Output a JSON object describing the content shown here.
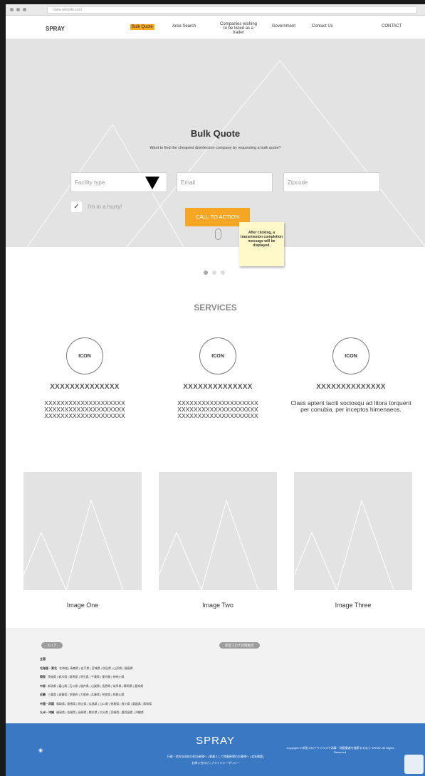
{
  "browser": {
    "url": "www.website.com"
  },
  "header": {
    "logo": "SPRAY",
    "nav": [
      {
        "label": "Bulk Quote",
        "active": true
      },
      {
        "label": "Area Search"
      },
      {
        "label": "Companies wishing to be listed as a trader"
      },
      {
        "label": "Government"
      },
      {
        "label": "Contact Us"
      }
    ],
    "contact": "CONTACT"
  },
  "hero": {
    "title": "Bulk Quote",
    "subtitle": "Want to find the cheapest disinfection company by requesting a bulk quote?",
    "facility_placeholder": "Facility type",
    "email_placeholder": "Email",
    "zipcode_placeholder": "Zipcode",
    "hurry_label": "I'm in a hurry!",
    "cta_label": "CALL TO ACTION",
    "note": "After clicking, a transmission completion message will be displayed."
  },
  "colors": {
    "accent": "#f5a623",
    "footer": "#3a78c4",
    "note": "#fff8c9"
  },
  "services": {
    "title": "SERVICES",
    "items": [
      {
        "icon": "ICON",
        "heading": "XXXXXXXXXXXXXX",
        "body": "XXXXXXXXXXXXXXXXXXXX XXXXXXXXXXXXXXXXXXXX XXXXXXXXXXXXXXXXXXXX"
      },
      {
        "icon": "ICON",
        "heading": "XXXXXXXXXXXXXX",
        "body": "XXXXXXXXXXXXXXXXXXXX XXXXXXXXXXXXXXXXXXXX XXXXXXXXXXXXXXXXXXXX"
      },
      {
        "icon": "ICON",
        "heading": "XXXXXXXXXXXXXX",
        "body": "Class aptent taciti sociosqu ad litora torquent per conubia, per inceptos himenaeos."
      }
    ]
  },
  "images": [
    {
      "caption": "Image One"
    },
    {
      "caption": "Image Two"
    },
    {
      "caption": "Image Three"
    }
  ],
  "area": {
    "pill_left": "エリア",
    "pill_right": "新型コロナ対策拠点",
    "rows": [
      {
        "region": "全国",
        "prefs": ""
      },
      {
        "region": "北海道・東北",
        "prefs": "北海道 | 青森県 | 岩手県 | 宮城県 | 秋田県 | 山形県 | 福島県"
      },
      {
        "region": "関東",
        "prefs": "茨城県 | 栃木県 | 群馬県 | 埼玉県 | 千葉県 | 東京都 | 神奈川県"
      },
      {
        "region": "中部",
        "prefs": "新潟県 | 富山県 | 石川県 | 福井県 | 山梨県 | 長野県 | 岐阜県 | 静岡県 | 愛知県"
      },
      {
        "region": "近畿",
        "prefs": "三重県 | 滋賀県 | 京都府 | 大阪府 | 兵庫県 | 奈良県 | 和歌山県"
      },
      {
        "region": "中国・四国",
        "prefs": "鳥取県 | 島根県 | 岡山県 | 広島県 | 山口県 | 徳島県 | 香川県 | 愛媛県 | 高知県"
      },
      {
        "region": "九州・沖縄",
        "prefs": "福岡県 | 佐賀県 | 長崎県 | 熊本県 | 大分県 | 宮崎県 | 鹿児島県 | 沖縄県"
      }
    ]
  },
  "footer": {
    "logo": "SPRAY",
    "links_line1": "行政・地方自治体の担当者様へ | 事業として掲載希望の企業様へ | 会社概要 |",
    "links_line2": "お問い合わせ | プライバシーポリシー",
    "copyright": "Copyright © 新型コロナウイルスで消毒・除菌業者を検索するなら SPRAY. All Rights Reserved.",
    "rss_icon": "rss-icon"
  }
}
